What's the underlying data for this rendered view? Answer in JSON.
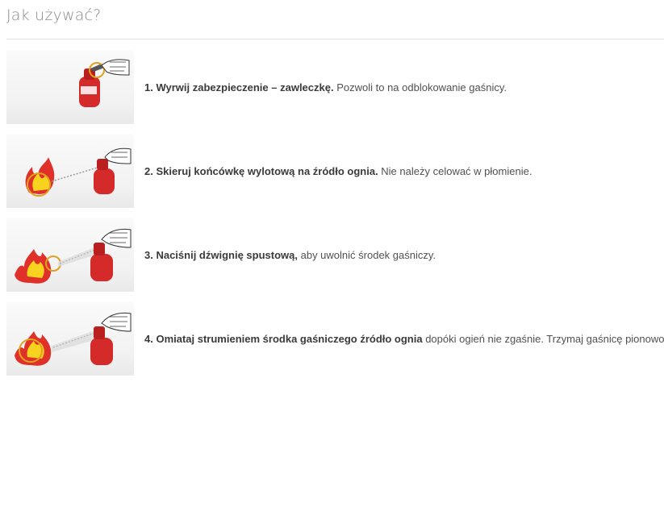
{
  "title": "Jak używać?",
  "steps": [
    {
      "bold": "1. Wyrwij zabezpieczenie – zawleczkę.",
      "rest": " Pozwoli to na odblokowanie gaśnicy.",
      "image": "extinguisher-pull-pin-icon"
    },
    {
      "bold": "2. Skieruj końcówkę wylotową na źródło ognia.",
      "rest": " Nie należy celować w płomienie.",
      "image": "extinguisher-aim-icon"
    },
    {
      "bold": "3. Naciśnij dźwignię spustową,",
      "rest": " aby uwolnić środek gaśniczy.",
      "image": "extinguisher-squeeze-icon"
    },
    {
      "bold": "4. Omiataj strumieniem środka gaśniczego źródło ognia",
      "rest": " dopóki ogień nie zgaśnie. Trzymaj gaśnicę pionowo.",
      "image": "extinguisher-sweep-icon"
    }
  ],
  "colors": {
    "extinguisher": "#d42a2a",
    "flame_yellow": "#f7d21e",
    "flame_red": "#e0302a",
    "ring": "#e0a020"
  }
}
